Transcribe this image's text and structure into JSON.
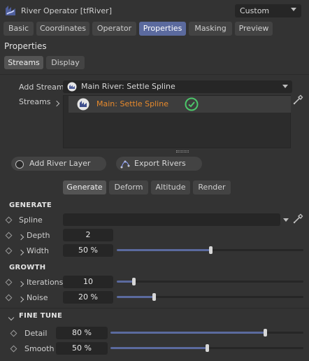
{
  "header": {
    "title": "River Operator [tfRiver]",
    "preset": "Custom"
  },
  "tabs": [
    {
      "label": "Basic",
      "active": false
    },
    {
      "label": "Coordinates",
      "active": false
    },
    {
      "label": "Operator",
      "active": false
    },
    {
      "label": "Properties",
      "active": true
    },
    {
      "label": "Masking",
      "active": false
    },
    {
      "label": "Preview",
      "active": false
    }
  ],
  "section_title": "Properties",
  "subtabs": [
    {
      "label": "Streams",
      "active": true
    },
    {
      "label": "Display",
      "active": false
    }
  ],
  "streams": {
    "add_stream_label": "Add Stream",
    "add_stream_value": "Main River: Settle Spline",
    "streams_label": "Streams",
    "items": [
      {
        "label": "Main: Settle Spline",
        "status": "ok"
      }
    ]
  },
  "actions": {
    "add_river_layer": "Add River Layer",
    "export_rivers": "Export Rivers"
  },
  "mode_tabs": [
    {
      "label": "Generate",
      "active": true
    },
    {
      "label": "Deform",
      "active": false
    },
    {
      "label": "Altitude",
      "active": false
    },
    {
      "label": "Render",
      "active": false
    }
  ],
  "generate": {
    "heading": "GENERATE",
    "spline_label": "Spline",
    "spline_value": "",
    "depth_label": "Depth",
    "depth_value": "2",
    "width_label": "Width",
    "width_value": "50 %",
    "width_fraction": 0.5
  },
  "growth": {
    "heading": "GROWTH",
    "iterations_label": "Iterations",
    "iterations_value": "10",
    "iterations_fraction": 0.09,
    "noise_label": "Noise",
    "noise_value": "20 %",
    "noise_fraction": 0.2
  },
  "fine_tune": {
    "heading": "FINE TUNE",
    "detail_label": "Detail",
    "detail_value": "80 %",
    "detail_fraction": 0.8,
    "smooth_label": "Smooth",
    "smooth_value": "50 %",
    "smooth_fraction": 0.5
  },
  "colors": {
    "accent": "#5b6a9e",
    "stream_text": "#e88a2c",
    "ok_green": "#4cc76a"
  }
}
